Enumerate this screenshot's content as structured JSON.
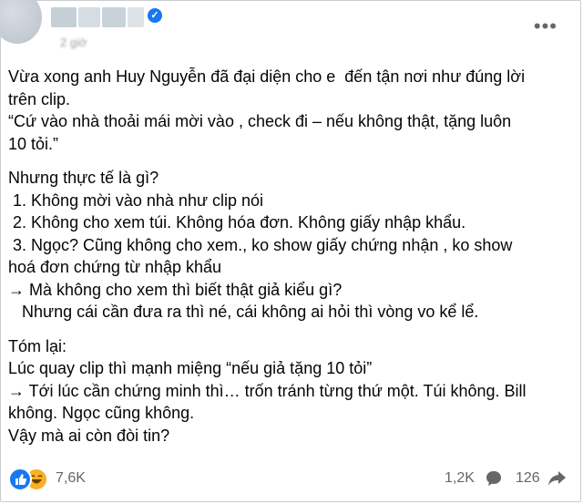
{
  "post": {
    "time_label": "2 giờ",
    "lines": [
      "Vừa xong anh Huy Nguyễn đã đại diện cho e  đến tận nơi như đúng lời",
      "trên clip.",
      "“Cứ vào nhà thoải mái mời vào , check đi – nếu không thật, tặng luôn",
      "10 tỏi.”",
      "",
      "Nhưng thực tế là gì?",
      " 1. Không mời vào nhà như clip nói",
      " 2. Không cho xem túi. Không hóa đơn. Không giấy nhập khẩu.",
      " 3. Ngọc? Cũng không cho xem., ko show giấy chứng nhận , ko show",
      "hoá đơn chứng từ nhập khẩu",
      "→ Mà không cho xem thì biết thật giả kiểu gì?",
      "   Nhưng cái cần đưa ra thì né, cái không ai hỏi thì vòng vo kể lể.",
      "",
      "Tóm lại:",
      "Lúc quay clip thì mạnh miệng “nếu giả tặng 10 tỏi”",
      "→ Tới lúc cần chứng minh thì… trốn tránh từng thứ một. Túi không. Bill",
      "không. Ngọc cũng không.",
      "Vậy mà ai còn đòi tin?"
    ]
  },
  "header": {
    "more_icon": "more-dots-icon",
    "verified_icon": "verified-badge-icon",
    "accent_color": "#1877f2"
  },
  "footer": {
    "reaction_count": "7,6K",
    "comment_count": "1,2K",
    "share_count": "126",
    "reaction_icons": [
      "like-icon",
      "haha-icon"
    ]
  }
}
